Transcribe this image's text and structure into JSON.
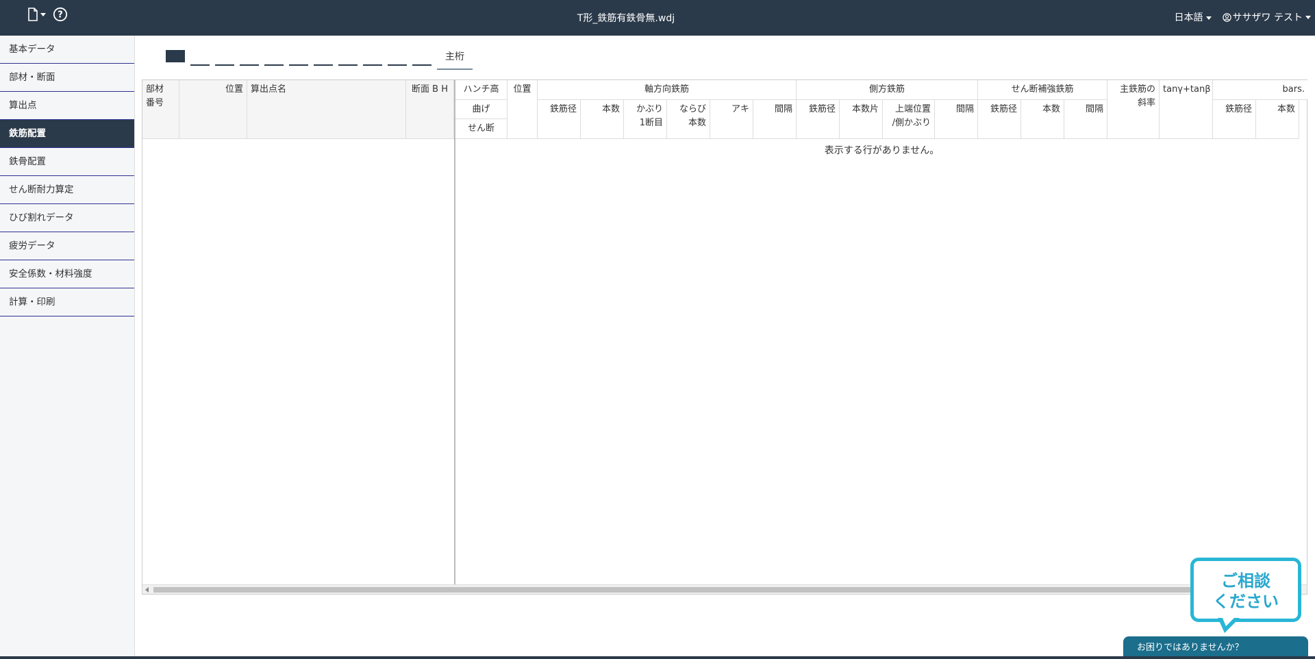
{
  "header": {
    "title": "T形_鉄筋有鉄骨無.wdj",
    "language": "日本語",
    "user": "ササザワ テスト"
  },
  "sidebar": {
    "items": [
      {
        "label": "基本データ"
      },
      {
        "label": "部材・断面"
      },
      {
        "label": "算出点"
      },
      {
        "label": "鉄筋配置",
        "active": true
      },
      {
        "label": "鉄骨配置"
      },
      {
        "label": "せん断耐力算定"
      },
      {
        "label": "ひび割れデータ"
      },
      {
        "label": "疲労データ"
      },
      {
        "label": "安全係数・材料強度"
      },
      {
        "label": "計算・印刷"
      }
    ]
  },
  "tabs": {
    "main_label": "主桁"
  },
  "grid": {
    "frozen_headers": {
      "member_no": "部材\n番号",
      "position": "位置",
      "calc_point_name": "算出点名",
      "section_bh": "断面 B H"
    },
    "headers": {
      "haunch_height": "ハンチ高",
      "bending": "曲げ",
      "shear": "せん断",
      "position": "位置",
      "axial_rebar": "軸方向鉄筋",
      "axial_diameter": "鉄筋径",
      "axial_count": "本数",
      "cover_1": "かぶり",
      "cover_2": "1断目",
      "rows_1": "ならび",
      "rows_2": "本数",
      "gap": "アキ",
      "interval": "間隔",
      "side_rebar": "側方鉄筋",
      "side_diameter": "鉄筋径",
      "side_count": "本数片",
      "top_pos_1": "上端位置",
      "top_pos_2": "/側かぶり",
      "side_interval": "間隔",
      "shear_rebar": "せん断補強鉄筋",
      "shear_diameter": "鉄筋径",
      "shear_count": "本数",
      "shear_interval": "間隔",
      "main_slope_1": "主鉄筋の",
      "main_slope_2": "斜率",
      "tan": "tanγ+tanβ",
      "bars": "bars.",
      "bars_diameter": "鉄筋径",
      "bars_count": "本数"
    },
    "empty_message": "表示する行がありません。"
  },
  "chat": {
    "bubble_line1": "ご相談",
    "bubble_line2": "ください",
    "bar_text": "お困りではありませんか？"
  }
}
